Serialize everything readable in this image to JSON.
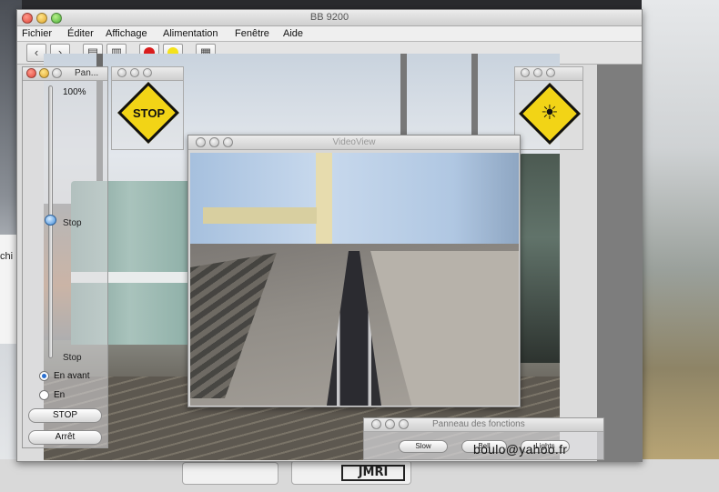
{
  "desktop": {
    "left_partial_label": "chi",
    "bottom_logo_text": "JMRI"
  },
  "main_window": {
    "title": "BB 9200",
    "menu": [
      "Fichier",
      "Éditer",
      "Affichage",
      "Alimentation",
      "Fenêtre",
      "Aide"
    ],
    "toolbar_icons": [
      "back-arrow-icon",
      "forward-arrow-icon",
      "document-icon",
      "trash-icon",
      "record-icon",
      "light-icon",
      "calculator-icon"
    ]
  },
  "throttle_panel": {
    "title": "Pan...",
    "speed_percent_label": "100%",
    "slider_mid_label": "Stop",
    "slider_bottom_label": "Stop",
    "direction_options": [
      {
        "label": "En avant",
        "selected": true
      },
      {
        "label": "En",
        "selected": false
      }
    ],
    "buttons": {
      "stop": "STOP",
      "arret": "Arrêt"
    }
  },
  "signs": {
    "stop_sign": {
      "text": "STOP",
      "color": "#f2d416"
    },
    "light_sign": {
      "icon": "lightbulb-icon",
      "color": "#f2d416"
    }
  },
  "video_view": {
    "title": "VideoView"
  },
  "functions_panel": {
    "title": "Panneau des fonctions",
    "buttons": [
      "Slow",
      "Bell",
      "Lights"
    ]
  },
  "watermark": "boulo@yahoo.fr"
}
